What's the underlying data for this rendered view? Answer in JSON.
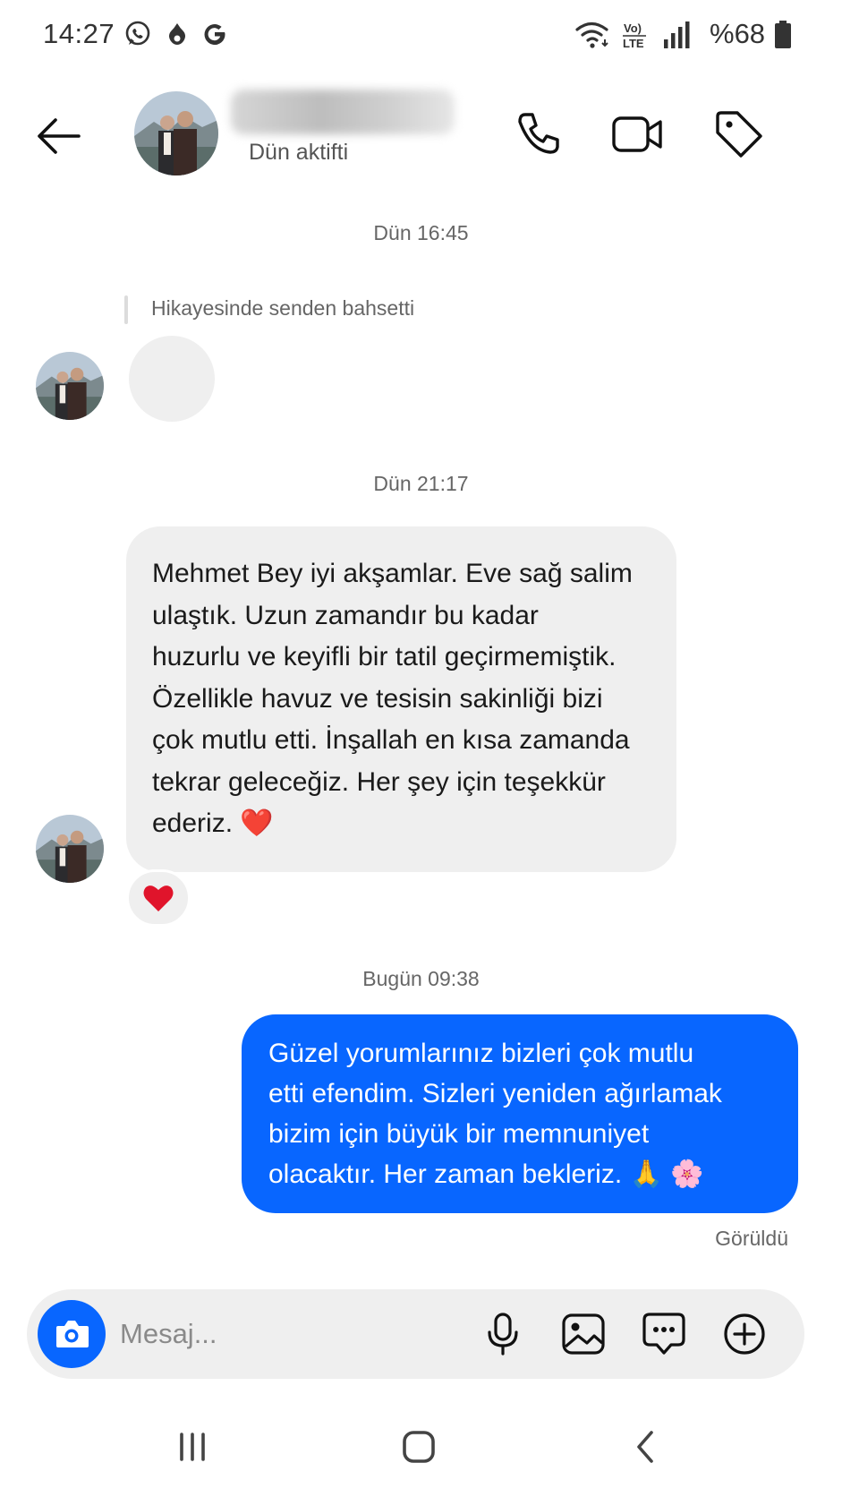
{
  "status_bar": {
    "time": "14:27",
    "battery": "%68",
    "network": "Vo) LTE"
  },
  "header": {
    "status": "Dün aktifti",
    "icons": [
      "back-arrow-icon",
      "phone-icon",
      "video-icon",
      "tag-icon"
    ]
  },
  "conversation": {
    "stamp_1": "Dün 16:45",
    "story_mention": "Hikayesinde senden bahsetti",
    "stamp_2": "Dün 21:17",
    "incoming_message": "Mehmet Bey iyi akşamlar. Eve sağ salim\nulaştık. Uzun zamandır bu kadar\nhuzurlu ve keyifli bir tatil geçirmemiştik.\nÖzellikle havuz ve tesisin sakinliği bizi\nçok mutlu etti. İnşallah en kısa zamanda\ntekrar geleceğiz. Her şey için teşekkür\nederiz. ❤️",
    "reaction": "❤️",
    "stamp_3": "Bugün 09:38",
    "outgoing_message": "Güzel yorumlarınız bizleri çok mutlu\netti efendim. Sizleri yeniden ağırlamak\nbizim için büyük bir memnuniyet\nolacaktır. Her zaman bekleriz. 🙏 🌸",
    "seen": "Görüldü"
  },
  "composer": {
    "placeholder": "Mesaj...",
    "icons": [
      "camera-icon",
      "microphone-icon",
      "gallery-icon",
      "sticker-icon",
      "plus-icon"
    ]
  },
  "colors": {
    "accent": "#0866ff",
    "incoming_bubble": "#efefef",
    "heart": "#e0142b"
  }
}
